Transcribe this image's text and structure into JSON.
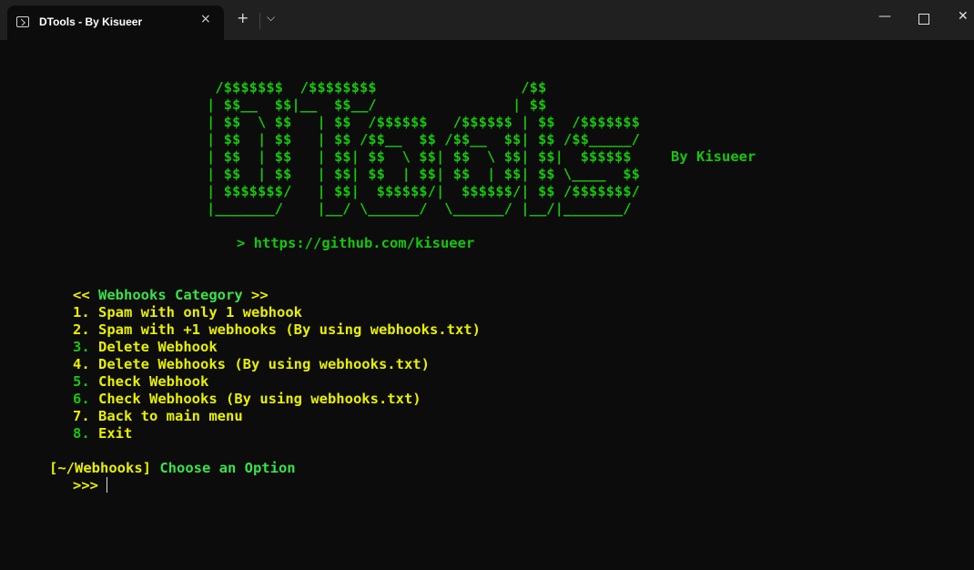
{
  "window": {
    "tab_title": "DTools - By Kisueer",
    "close_icon": "×",
    "new_tab_icon": "+",
    "dropdown_icon": "⌵",
    "minimize_icon": "—",
    "close_window_icon": "✕"
  },
  "banner": {
    "lines": [
      " /$$$$$$$  /$$$$$$$$                 /$$",
      "| $$__  $$|__  $$__/                | $$",
      "| $$  \\ $$   | $$  /$$$$$$   /$$$$$$ | $$  /$$$$$$$",
      "| $$  | $$   | $$ /$$__  $$ /$$__  $$| $$ /$$_____/",
      "| $$  | $$   | $$| $$  \\ $$| $$  \\ $$| $$|  $$$$$$",
      "| $$  | $$   | $$| $$  | $$| $$  | $$| $$ \\____  $$",
      "| $$$$$$$/   | $$|  $$$$$$/|  $$$$$$/| $$ /$$$$$$$/",
      "|_______/    |__/ \\______/  \\______/ |__/|_______/"
    ],
    "author": "By Kisueer",
    "github": "> https://github.com/kisueer"
  },
  "menu": {
    "category_open": "<<",
    "category": "Webhooks Category",
    "category_close": ">>",
    "items": [
      {
        "num": "1.",
        "text": "Spam with only 1 webhook"
      },
      {
        "num": "2.",
        "text": "Spam with +1 webhooks (By using webhooks.txt)"
      },
      {
        "num": "3.",
        "text": "Delete Webhook"
      },
      {
        "num": "4.",
        "text": "Delete Webhooks (By using webhooks.txt)"
      },
      {
        "num": "5.",
        "text": "Check Webhook"
      },
      {
        "num": "6.",
        "text": "Check Webhooks (By using webhooks.txt)"
      },
      {
        "num": "7.",
        "text": "Back to main menu"
      },
      {
        "num": "8.",
        "text": "Exit"
      }
    ]
  },
  "prompt": {
    "path": "[~/Webhooks]",
    "text": "Choose an Option",
    "input": ">>>"
  }
}
